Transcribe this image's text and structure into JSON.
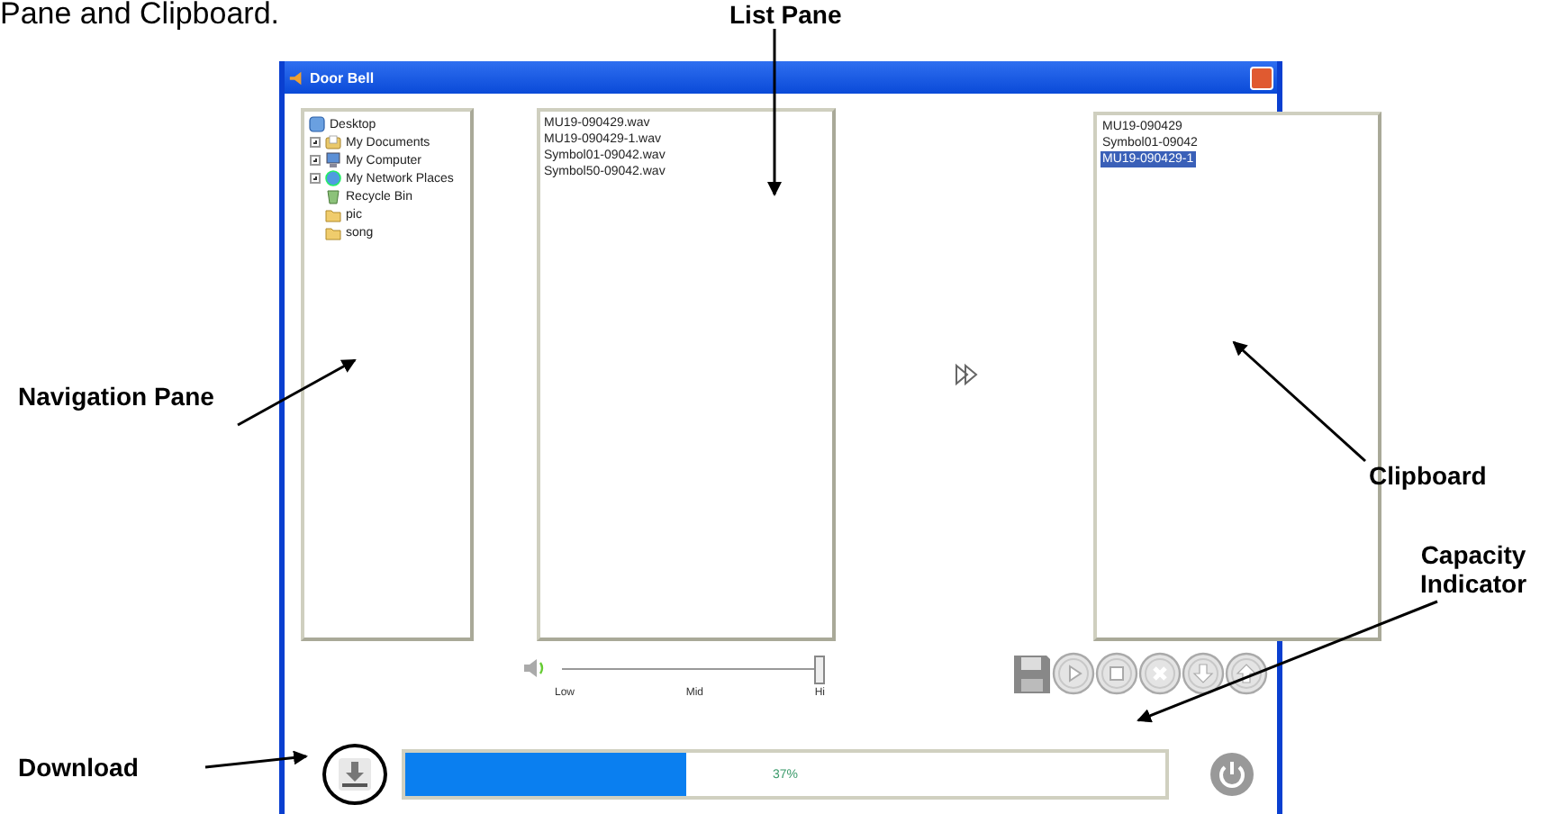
{
  "caption": "Pane and Clipboard.",
  "window": {
    "title": "Door Bell"
  },
  "navigation_pane": {
    "root": {
      "label": "Desktop",
      "kind": "desktop",
      "children": [
        {
          "label": "My Documents",
          "kind": "documents",
          "expandable": true
        },
        {
          "label": "My Computer",
          "kind": "computer",
          "expandable": true
        },
        {
          "label": "My Network Places",
          "kind": "network",
          "expandable": true
        },
        {
          "label": "Recycle Bin",
          "kind": "recycle",
          "expandable": false
        },
        {
          "label": "pic",
          "kind": "folder",
          "expandable": false
        },
        {
          "label": "song",
          "kind": "folder",
          "expandable": false
        }
      ]
    }
  },
  "list_pane": {
    "items": [
      "MU19-090429.wav",
      "MU19-090429-1.wav",
      "Symbol01-09042.wav",
      "Symbol50-09042.wav"
    ]
  },
  "clipboard": {
    "items": [
      {
        "label": "MU19-090429",
        "selected": false
      },
      {
        "label": "Symbol01-09042",
        "selected": false
      },
      {
        "label": "MU19-090429-1",
        "selected": true
      }
    ]
  },
  "volume": {
    "level": 1,
    "ticks": [
      "Low",
      "Mid",
      "Hi"
    ]
  },
  "capacity": {
    "level": 0.37,
    "reading": "37%"
  },
  "annotations": [
    {
      "label": "List Pane",
      "kind": "list"
    },
    {
      "label": "Navigation Pane",
      "kind": "navigation"
    },
    {
      "label": "Clipboard",
      "kind": "clipboard"
    },
    {
      "label": "Capacity Indicator",
      "kind": "capacity"
    },
    {
      "label": "Download",
      "kind": "download"
    }
  ]
}
